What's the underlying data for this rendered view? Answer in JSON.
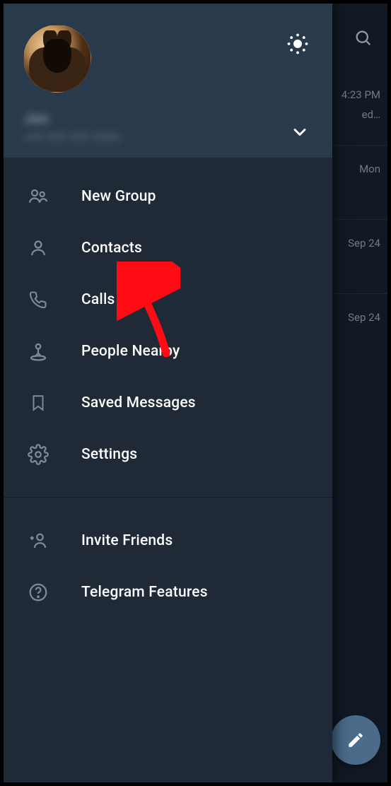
{
  "header": {
    "profile_name": "Jen",
    "profile_phone": "+00 000 000 0000"
  },
  "menu": {
    "items": [
      {
        "key": "new-group",
        "label": "New Group"
      },
      {
        "key": "contacts",
        "label": "Contacts"
      },
      {
        "key": "calls",
        "label": "Calls"
      },
      {
        "key": "people-nearby",
        "label": "People Nearby"
      },
      {
        "key": "saved-messages",
        "label": "Saved Messages"
      },
      {
        "key": "settings",
        "label": "Settings"
      }
    ],
    "secondary": [
      {
        "key": "invite-friends",
        "label": "Invite Friends"
      },
      {
        "key": "telegram-features",
        "label": "Telegram Features"
      }
    ]
  },
  "background_chat": {
    "time1": "4:23 PM",
    "preview1": "ed…",
    "time2": "Mon",
    "time3": "Sep 24",
    "time4": "Sep 24"
  },
  "annotation": {
    "color": "#ff0b16"
  }
}
